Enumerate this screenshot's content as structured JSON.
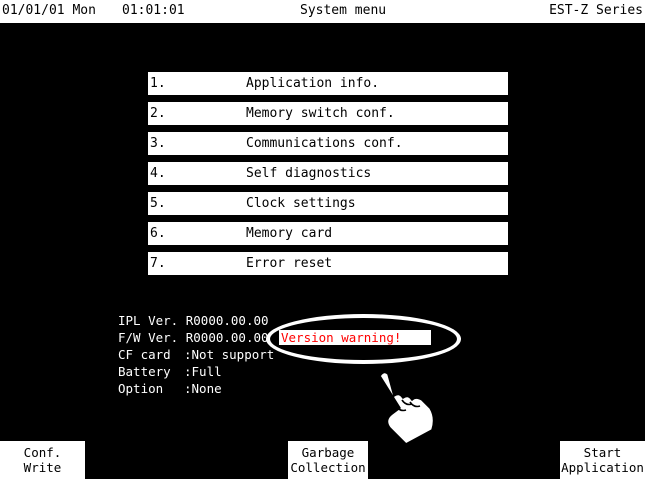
{
  "header": {
    "date": "01/01/01 Mon",
    "time": "01:01:01",
    "title": "System menu",
    "series": "EST-Z Series"
  },
  "menu": [
    {
      "num": "1.",
      "label": "Application info."
    },
    {
      "num": "2.",
      "label": "Memory switch conf."
    },
    {
      "num": "3.",
      "label": "Communications conf."
    },
    {
      "num": "4.",
      "label": "Self diagnostics"
    },
    {
      "num": "5.",
      "label": "Clock settings"
    },
    {
      "num": "6.",
      "label": "Memory card"
    },
    {
      "num": "7.",
      "label": "Error reset"
    }
  ],
  "info": {
    "ipl_label": "IPL Ver.",
    "ipl_value": "R0000.00.00",
    "fw_label": "F/W Ver.",
    "fw_value": "R0000.00.00",
    "cf_label": "CF card",
    "cf_value": "Not support",
    "battery_label": "Battery",
    "battery_value": "Full",
    "option_label": "Option",
    "option_value": "None",
    "warning": "Version warning!"
  },
  "softkeys": {
    "left_line1": "Conf.",
    "left_line2": "Write",
    "mid_line1": "Garbage",
    "mid_line2": "Collection",
    "right_line1": "Start",
    "right_line2": "Application"
  },
  "colors": {
    "background": "#000000",
    "panel": "#ffffff",
    "warning_text": "#ff0000"
  },
  "icons": {
    "pointer": "pointing-hand-icon"
  }
}
